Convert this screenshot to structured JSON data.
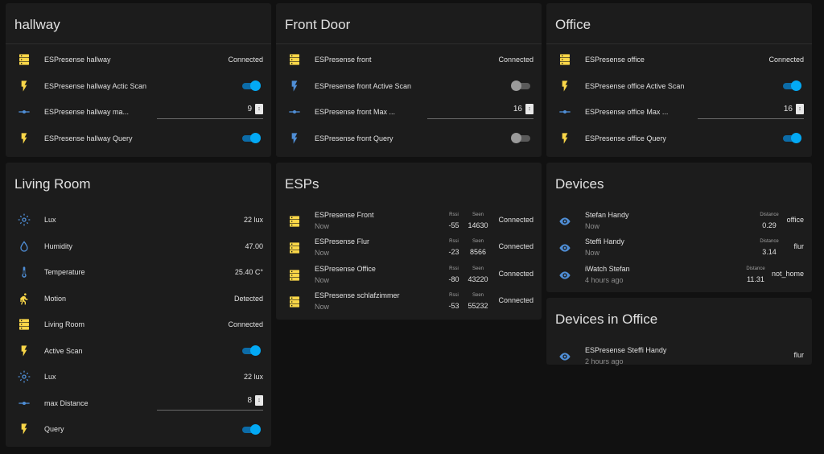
{
  "colors": {
    "yellow": "#f9d648",
    "blue": "#4f8ed6",
    "accent": "#03a9f4",
    "muted_blue": "#5b7fb5"
  },
  "hallway": {
    "title": "hallway",
    "rows": [
      {
        "label": "ESPresense hallway",
        "value": "Connected"
      },
      {
        "label": "ESPresense hallway Actic Scan",
        "toggle": "on"
      },
      {
        "label": "ESPresense hallway ma...",
        "number": "9"
      },
      {
        "label": "ESPresense hallway Query",
        "toggle": "on"
      }
    ]
  },
  "front_door": {
    "title": "Front Door",
    "rows": [
      {
        "label": "ESPresense front",
        "value": "Connected"
      },
      {
        "label": "ESPresense front Active Scan",
        "toggle": "off"
      },
      {
        "label": "ESPresense front Max ...",
        "number": "16"
      },
      {
        "label": "ESPresense front Query",
        "toggle": "off"
      }
    ]
  },
  "office": {
    "title": "Office",
    "rows": [
      {
        "label": "ESPresense office",
        "value": "Connected"
      },
      {
        "label": "ESPresense office Active Scan",
        "toggle": "on"
      },
      {
        "label": "ESPresense office Max ...",
        "number": "16"
      },
      {
        "label": "ESPresense office Query",
        "toggle": "on"
      }
    ]
  },
  "living_room": {
    "title": "Living Room",
    "rows": [
      {
        "label": "Lux",
        "value": "22 lux"
      },
      {
        "label": "Humidity",
        "value": "47.00"
      },
      {
        "label": "Temperature",
        "value": "25.40 C°"
      },
      {
        "label": "Motion",
        "value": "Detected"
      },
      {
        "label": "Living Room",
        "value": "Connected"
      },
      {
        "label": "Active Scan",
        "toggle": "on"
      },
      {
        "label": "Lux",
        "value": "22 lux"
      },
      {
        "label": "max Distance",
        "number": "8"
      },
      {
        "label": "Query",
        "toggle": "on"
      }
    ]
  },
  "esps": {
    "title": "ESPs",
    "rssi_header": "Rssi",
    "seen_header": "Seen",
    "rows": [
      {
        "name": "ESPresense Front",
        "sub": "Now",
        "rssi": "-55",
        "seen": "14630",
        "state": "Connected"
      },
      {
        "name": "ESPresense Flur",
        "sub": "Now",
        "rssi": "-23",
        "seen": "8566",
        "state": "Connected"
      },
      {
        "name": "ESPresense Office",
        "sub": "Now",
        "rssi": "-80",
        "seen": "43220",
        "state": "Connected"
      },
      {
        "name": "ESPresense schlafzimmer",
        "sub": "Now",
        "rssi": "-53",
        "seen": "55232",
        "state": "Connected"
      }
    ]
  },
  "devices": {
    "title": "Devices",
    "distance_header": "Distance",
    "rows": [
      {
        "name": "Stefan Handy",
        "sub": "Now",
        "distance": "0.29",
        "state": "office"
      },
      {
        "name": "Steffi Handy",
        "sub": "Now",
        "distance": "3.14",
        "state": "flur"
      },
      {
        "name": "iWatch Stefan",
        "sub": "4 hours ago",
        "distance": "11.31",
        "state": "not_home"
      }
    ]
  },
  "devices_in_office": {
    "title": "Devices in Office",
    "rows": [
      {
        "name": "ESPresense Steffi Handy",
        "sub": "2 hours ago",
        "state": "flur"
      }
    ]
  }
}
